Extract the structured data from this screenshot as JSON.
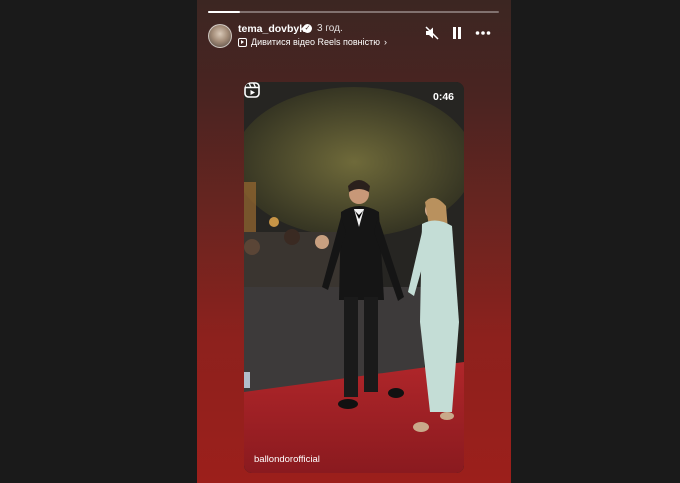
{
  "story": {
    "username": "tema_dovbyk",
    "time_ago": "3 год.",
    "reels_link": "Дивитися відео Reels повністю",
    "reels_chevron": "›",
    "progress_fraction": 0.11,
    "controls": {
      "mute_icon": "speaker-muted-icon",
      "pause_icon": "pause-icon",
      "more_icon": "more-icon"
    }
  },
  "video": {
    "duration": "0:46",
    "credit": "ballondorofficial",
    "reels_icon": "reels-icon"
  },
  "colors": {
    "story_bg_top": "#3c2622",
    "story_bg_bottom": "#9c1f1b",
    "side_panel": "#1a1a1a"
  }
}
